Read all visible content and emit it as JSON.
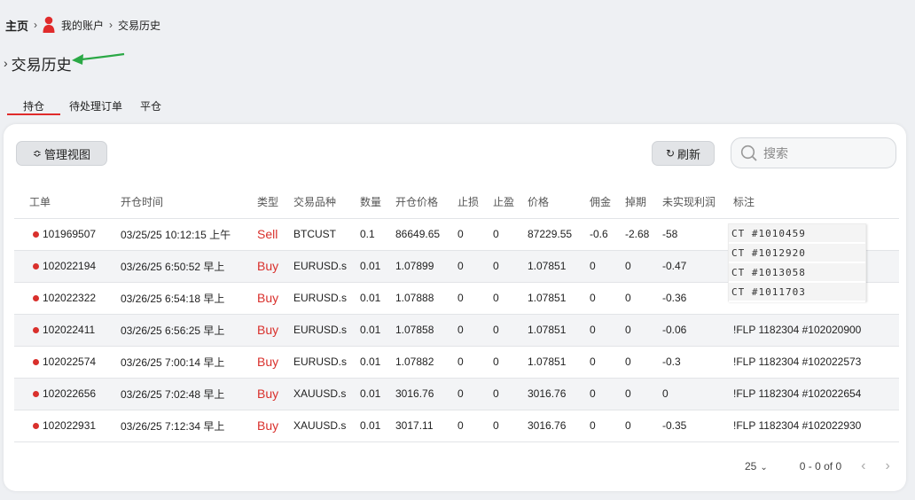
{
  "breadcrumb": {
    "home": "主页",
    "account": "我的账户",
    "history": "交易历史"
  },
  "page": {
    "title": "交易历史"
  },
  "tabs": [
    {
      "label": "持仓"
    },
    {
      "label": "待处理订单"
    },
    {
      "label": "平仓"
    }
  ],
  "toolbar": {
    "manage_label": "管理视图",
    "refresh_label": "刷新",
    "search_placeholder": "搜索"
  },
  "table": {
    "headers": [
      "工单",
      "开仓时间",
      "类型",
      "交易品种",
      "数量",
      "开仓价格",
      "止损",
      "止盈",
      "价格",
      "佣金",
      "掉期",
      "未实现利润",
      "标注"
    ],
    "rows": [
      {
        "ticket": "101969507",
        "time": "03/25/25 10:12:15 上午",
        "type": "Sell",
        "symbol": "BTCUST",
        "qty": "0.1",
        "open": "86649.65",
        "sl": "0",
        "tp": "0",
        "price": "87229.55",
        "comm": "-0.6",
        "swap": "-2.68",
        "pnl": "-58",
        "note": ""
      },
      {
        "ticket": "102022194",
        "time": "03/26/25 6:50:52 早上",
        "type": "Buy",
        "symbol": "EURUSD.s",
        "qty": "0.01",
        "open": "1.07899",
        "sl": "0",
        "tp": "0",
        "price": "1.07851",
        "comm": "0",
        "swap": "0",
        "pnl": "-0.47",
        "note": ""
      },
      {
        "ticket": "102022322",
        "time": "03/26/25 6:54:18 早上",
        "type": "Buy",
        "symbol": "EURUSD.s",
        "qty": "0.01",
        "open": "1.07888",
        "sl": "0",
        "tp": "0",
        "price": "1.07851",
        "comm": "0",
        "swap": "0",
        "pnl": "-0.36",
        "note": ""
      },
      {
        "ticket": "102022411",
        "time": "03/26/25 6:56:25 早上",
        "type": "Buy",
        "symbol": "EURUSD.s",
        "qty": "0.01",
        "open": "1.07858",
        "sl": "0",
        "tp": "0",
        "price": "1.07851",
        "comm": "0",
        "swap": "0",
        "pnl": "-0.06",
        "note": "!FLP 1182304 #102020900"
      },
      {
        "ticket": "102022574",
        "time": "03/26/25 7:00:14 早上",
        "type": "Buy",
        "symbol": "EURUSD.s",
        "qty": "0.01",
        "open": "1.07882",
        "sl": "0",
        "tp": "0",
        "price": "1.07851",
        "comm": "0",
        "swap": "0",
        "pnl": "-0.3",
        "note": "!FLP 1182304 #102022573"
      },
      {
        "ticket": "102022656",
        "time": "03/26/25 7:02:48 早上",
        "type": "Buy",
        "symbol": "XAUUSD.s",
        "qty": "0.01",
        "open": "3016.76",
        "sl": "0",
        "tp": "0",
        "price": "3016.76",
        "comm": "0",
        "swap": "0",
        "pnl": "0",
        "note": "!FLP 1182304 #102022654"
      },
      {
        "ticket": "102022931",
        "time": "03/26/25 7:12:34 早上",
        "type": "Buy",
        "symbol": "XAUUSD.s",
        "qty": "0.01",
        "open": "3017.11",
        "sl": "0",
        "tp": "0",
        "price": "3016.76",
        "comm": "0",
        "swap": "0",
        "pnl": "-0.35",
        "note": "!FLP 1182304 #102022930"
      }
    ]
  },
  "overlay_notes": [
    "CT #1010459",
    "CT #1012920",
    "CT #1013058",
    "CT #1011703"
  ],
  "pager": {
    "page_size": "25",
    "range": "0 - 0 of 0"
  },
  "colors": {
    "accent": "#e02b2b",
    "sell_buy": "#d9302c",
    "arrow": "#2aa845"
  }
}
